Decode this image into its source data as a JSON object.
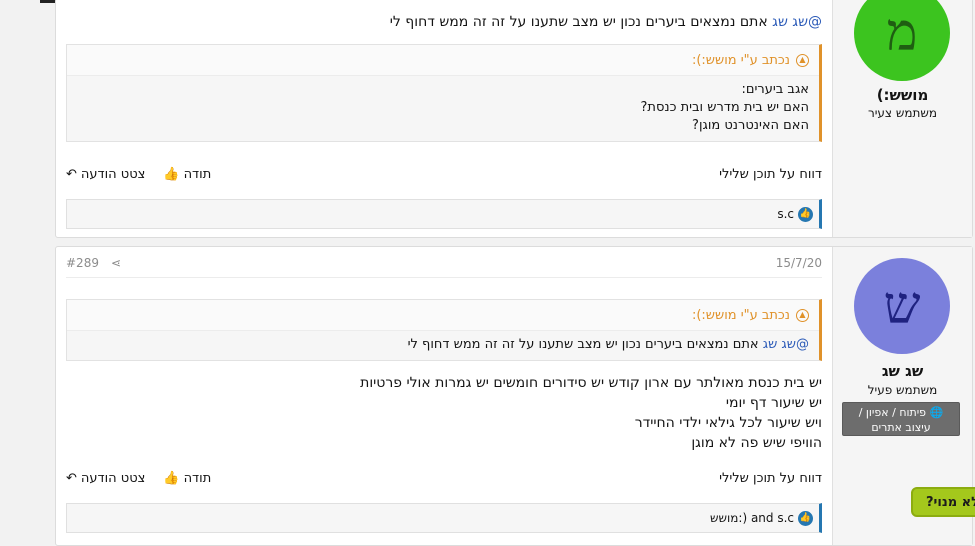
{
  "post1": {
    "user": {
      "avatar_letter": "מ",
      "avatar_color": "#3cc41f",
      "name": "מושש:)",
      "title": "משתמש צעיר"
    },
    "text_mention": "@שג שג",
    "text_rest": " אתם נמצאים ביערים נכון יש מצב שתענו על זה זה ממש דחוף לי",
    "quote": {
      "header": "נכתב ע\"י מושש:):",
      "lines": [
        "אגב ביערים:",
        "האם יש בית מדרש ובית כנסת?",
        "האם האינטרנט מוגן?"
      ]
    },
    "actions": {
      "quote_label": "צטט הודעה",
      "thanks_label": "תודה",
      "report_label": "דווח על תוכן שלילי"
    },
    "reactions_text": "s.c"
  },
  "post2": {
    "date": "15/7/20",
    "post_number": "#289",
    "user": {
      "avatar_letter": "ש",
      "avatar_color": "#7b80dc",
      "name": "שג שג",
      "title": "משתמש פעיל",
      "banner_line1": "פיתוח / אפיון /",
      "banner_line2": "עיצוב אתרים"
    },
    "quote": {
      "header": "נכתב ע\"י מושש:):",
      "mention": "@שג שג",
      "rest": " אתם נמצאים ביערים נכון יש מצב שתענו על זה זה ממש דחוף לי"
    },
    "lines": [
      "יש בית כנסת מאולתר עם ארון קודש יש סידורים חומשים יש גמרות אולי פרטיות",
      "יש שיעור דף יומי",
      "ויש שיעור לכל גילאי ילדי החיידר",
      "הוויפי שיש פה לא מוגן"
    ],
    "actions": {
      "quote_label": "צטט הודעה",
      "thanks_label": "תודה",
      "report_label": "דווח על תוכן שלילי"
    },
    "reactions_text": "מושש:) and s.c"
  },
  "help_button": "לא מנוי?"
}
